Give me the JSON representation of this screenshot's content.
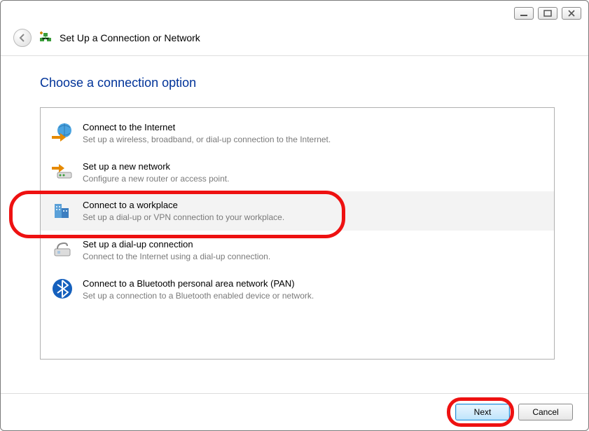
{
  "header": {
    "title": "Set Up a Connection or Network"
  },
  "page": {
    "heading": "Choose a connection option"
  },
  "options": [
    {
      "title": "Connect to the Internet",
      "desc": "Set up a wireless, broadband, or dial-up connection to the Internet."
    },
    {
      "title": "Set up a new network",
      "desc": "Configure a new router or access point."
    },
    {
      "title": "Connect to a workplace",
      "desc": "Set up a dial-up or VPN connection to your workplace."
    },
    {
      "title": "Set up a dial-up connection",
      "desc": "Connect to the Internet using a dial-up connection."
    },
    {
      "title": "Connect to a Bluetooth personal area network (PAN)",
      "desc": "Set up a connection to a Bluetooth enabled device or network."
    }
  ],
  "buttons": {
    "next": "Next",
    "cancel": "Cancel"
  }
}
